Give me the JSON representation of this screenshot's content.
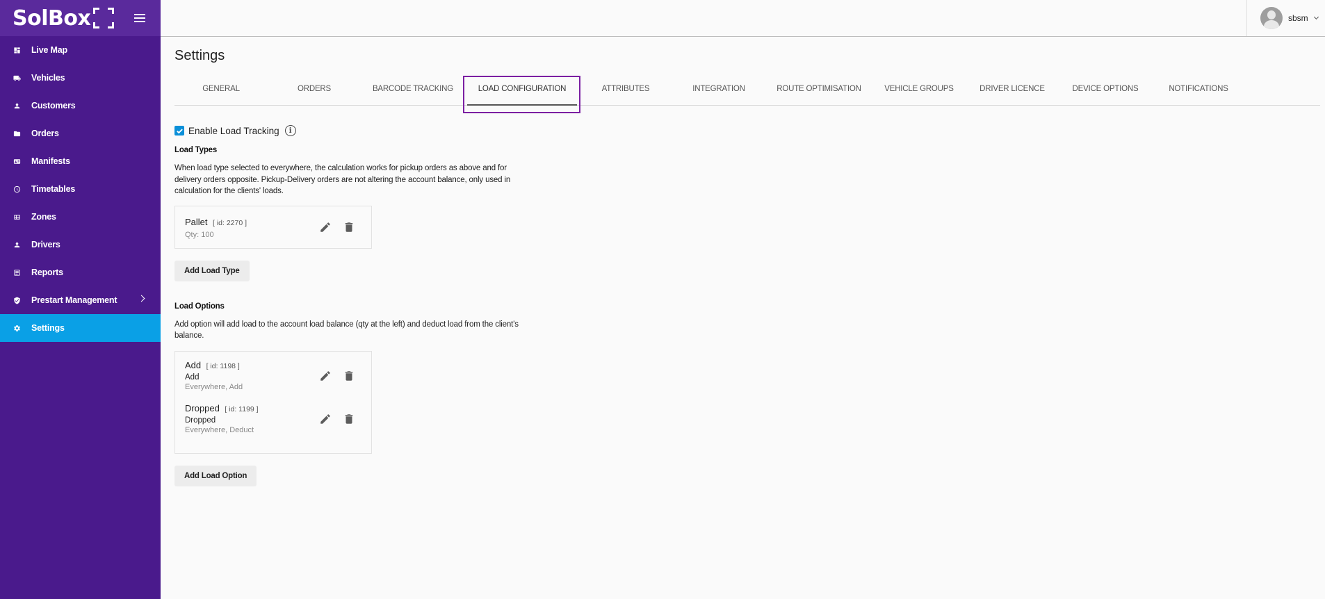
{
  "brand": {
    "logo_text": "SolBox"
  },
  "sidebar": {
    "items": [
      {
        "label": "Live Map",
        "icon": "dashboard-icon"
      },
      {
        "label": "Vehicles",
        "icon": "truck-icon"
      },
      {
        "label": "Customers",
        "icon": "person-icon"
      },
      {
        "label": "Orders",
        "icon": "folder-icon"
      },
      {
        "label": "Manifests",
        "icon": "id-card-icon"
      },
      {
        "label": "Timetables",
        "icon": "clock-icon"
      },
      {
        "label": "Zones",
        "icon": "grid-icon"
      },
      {
        "label": "Drivers",
        "icon": "person-icon"
      },
      {
        "label": "Reports",
        "icon": "report-icon"
      },
      {
        "label": "Prestart Management",
        "icon": "shield-icon"
      },
      {
        "label": "Settings",
        "icon": "gear-icon"
      }
    ],
    "active": "Settings",
    "accent_color": "#4a1a8c",
    "active_color": "#0aa0e6"
  },
  "user": {
    "name": "sbsm"
  },
  "page": {
    "title": "Settings"
  },
  "tabs": [
    {
      "label": "GENERAL"
    },
    {
      "label": "ORDERS"
    },
    {
      "label": "BARCODE TRACKING"
    },
    {
      "label": "LOAD CONFIGURATION"
    },
    {
      "label": "ATTRIBUTES"
    },
    {
      "label": "INTEGRATION"
    },
    {
      "label": "ROUTE OPTIMISATION"
    },
    {
      "label": "VEHICLE GROUPS"
    },
    {
      "label": "DRIVER LICENCE"
    },
    {
      "label": "DEVICE OPTIONS"
    },
    {
      "label": "NOTIFICATIONS"
    }
  ],
  "active_tab": "LOAD CONFIGURATION",
  "load_tracking": {
    "label": "Enable Load Tracking",
    "checked": true
  },
  "load_types": {
    "title": "Load Types",
    "description": "When load type selected to everywhere, the calculation works for pickup orders as above and for delivery orders opposite. Pickup-Delivery orders are not altering the account balance, only used in calculation for the clients' loads.",
    "items": [
      {
        "name": "Pallet",
        "id_text": "[ id: 2270 ]",
        "meta": "Qty: 100"
      }
    ],
    "add_button": "Add Load Type"
  },
  "load_options": {
    "title": "Load Options",
    "description": "Add option will add load to the account load balance (qty at the left) and deduct load from the client's balance.",
    "items": [
      {
        "name": "Add",
        "id_text": "[ id: 1198 ]",
        "sub": "Add",
        "meta": "Everywhere, Add"
      },
      {
        "name": "Dropped",
        "id_text": "[ id: 1199 ]",
        "sub": "Dropped",
        "meta": "Everywhere, Deduct"
      }
    ],
    "add_button": "Add Load Option"
  }
}
